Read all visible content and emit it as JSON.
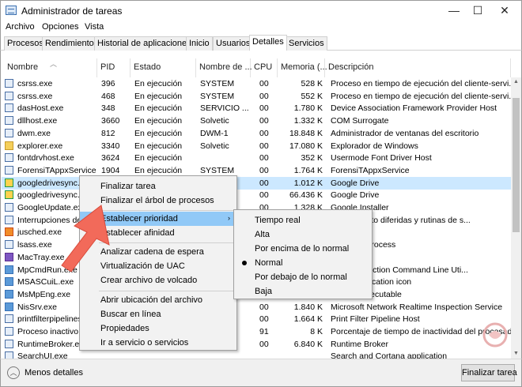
{
  "window": {
    "title": "Administrador de tareas",
    "minimize": "—",
    "maximize": "☐",
    "close": "✕"
  },
  "menubar": [
    "Archivo",
    "Opciones",
    "Vista"
  ],
  "tabs": [
    "Procesos",
    "Rendimiento",
    "Historial de aplicaciones",
    "Inicio",
    "Usuarios",
    "Detalles",
    "Servicios"
  ],
  "active_tab": "Detalles",
  "columns": [
    "Nombre",
    "PID",
    "Estado",
    "Nombre de ...",
    "CPU",
    "Memoria (...",
    "Descripción"
  ],
  "rows": [
    {
      "name": "csrss.exe",
      "pid": "396",
      "status": "En ejecución",
      "user": "SYSTEM",
      "cpu": "00",
      "mem": "528 K",
      "desc": "Proceso en tiempo de ejecución del cliente-servi..."
    },
    {
      "name": "csrss.exe",
      "pid": "468",
      "status": "En ejecución",
      "user": "SYSTEM",
      "cpu": "00",
      "mem": "552 K",
      "desc": "Proceso en tiempo de ejecución del cliente-servi..."
    },
    {
      "name": "dasHost.exe",
      "pid": "348",
      "status": "En ejecución",
      "user": "SERVICIO ...",
      "cpu": "00",
      "mem": "1.780 K",
      "desc": "Device Association Framework Provider Host"
    },
    {
      "name": "dllhost.exe",
      "pid": "3660",
      "status": "En ejecución",
      "user": "Solvetic",
      "cpu": "00",
      "mem": "1.332 K",
      "desc": "COM Surrogate"
    },
    {
      "name": "dwm.exe",
      "pid": "812",
      "status": "En ejecución",
      "user": "DWM-1",
      "cpu": "00",
      "mem": "18.848 K",
      "desc": "Administrador de ventanas del escritorio"
    },
    {
      "name": "explorer.exe",
      "pid": "3340",
      "status": "En ejecución",
      "user": "Solvetic",
      "cpu": "00",
      "mem": "17.080 K",
      "desc": "Explorador de Windows"
    },
    {
      "name": "fontdrvhost.exe",
      "pid": "3624",
      "status": "En ejecución",
      "user": "",
      "cpu": "00",
      "mem": "352 K",
      "desc": "Usermode Font Driver Host"
    },
    {
      "name": "ForensiTAppxService...",
      "pid": "1904",
      "status": "En ejecución",
      "user": "SYSTEM",
      "cpu": "00",
      "mem": "1.764 K",
      "desc": "ForensiTAppxService"
    },
    {
      "name": "googledrivesync.e...",
      "pid": "",
      "status": "",
      "user": "",
      "cpu": "00",
      "mem": "1.012 K",
      "desc": "Google Drive"
    },
    {
      "name": "googledrivesync.e...",
      "pid": "",
      "status": "",
      "user": "",
      "cpu": "00",
      "mem": "66.436 K",
      "desc": "Google Drive"
    },
    {
      "name": "GoogleUpdate.exe",
      "pid": "",
      "status": "",
      "user": "",
      "cpu": "00",
      "mem": "1.328 K",
      "desc": "Google Installer"
    },
    {
      "name": "Interrupciones del",
      "pid": "",
      "status": "",
      "user": "",
      "cpu": "",
      "mem": "",
      "desc": "rocedimiento diferidas y rutinas de s..."
    },
    {
      "name": "jusched.exe",
      "pid": "",
      "status": "",
      "user": "",
      "cpu": "",
      "mem": "",
      "desc": "Scheduler"
    },
    {
      "name": "lsass.exe",
      "pid": "",
      "status": "",
      "user": "",
      "cpu": "",
      "mem": "",
      "desc": "Authority Process"
    },
    {
      "name": "MacTray.exe",
      "pid": "",
      "status": "",
      "user": "",
      "cpu": "",
      "mem": "",
      "desc": ""
    },
    {
      "name": "MpCmdRun.exe",
      "pid": "",
      "status": "",
      "user": "",
      "cpu": "",
      "mem": "",
      "desc": "lware Protection Command Line Uti..."
    },
    {
      "name": "MSASCuiL.exe",
      "pid": "",
      "status": "",
      "user": "",
      "cpu": "",
      "mem": "",
      "desc": "ender notification icon"
    },
    {
      "name": "MsMpEng.exe",
      "pid": "",
      "status": "",
      "user": "",
      "cpu": "",
      "mem": "",
      "desc": "Service Executable"
    },
    {
      "name": "NisSrv.exe",
      "pid": "",
      "status": "",
      "user": "",
      "cpu": "00",
      "mem": "1.840 K",
      "desc": "Microsoft Network Realtime Inspection Service"
    },
    {
      "name": "printfilterpipelines",
      "pid": "",
      "status": "",
      "user": "",
      "cpu": "00",
      "mem": "1.664 K",
      "desc": "Print Filter Pipeline Host"
    },
    {
      "name": "Proceso inactivo c",
      "pid": "",
      "status": "",
      "user": "",
      "cpu": "91",
      "mem": "8 K",
      "desc": "Porcentaje de tiempo de inactividad del procesad..."
    },
    {
      "name": "RuntimeBroker.exe",
      "pid": "",
      "status": "",
      "user": "",
      "cpu": "00",
      "mem": "6.840 K",
      "desc": "Runtime Broker"
    },
    {
      "name": "SearchUI.exe",
      "pid": "",
      "status": "",
      "user": "",
      "cpu": "",
      "mem": "",
      "desc": "Search and Cortana application"
    }
  ],
  "context_menu": {
    "items": [
      "Finalizar tarea",
      "Finalizar el árbol de procesos",
      "Establecer prioridad",
      "Establecer afinidad",
      "Analizar cadena de espera",
      "Virtualización de UAC",
      "Crear archivo de volcado",
      "Abrir ubicación del archivo",
      "Buscar en línea",
      "Propiedades",
      "Ir a servicio o servicios"
    ],
    "submenu_arrow": "›"
  },
  "priority_menu": {
    "items": [
      "Tiempo real",
      "Alta",
      "Por encima de lo normal",
      "Normal",
      "Por debajo de lo normal",
      "Baja"
    ],
    "selected": "Normal"
  },
  "footer": {
    "less_details": "Menos detalles",
    "less_icon": "︿",
    "end_task": "Finalizar tarea"
  },
  "accent_colors": {
    "selection": "#cce8ff",
    "menu_highlight": "#91c9f7",
    "arrow": "#f26a5a"
  }
}
